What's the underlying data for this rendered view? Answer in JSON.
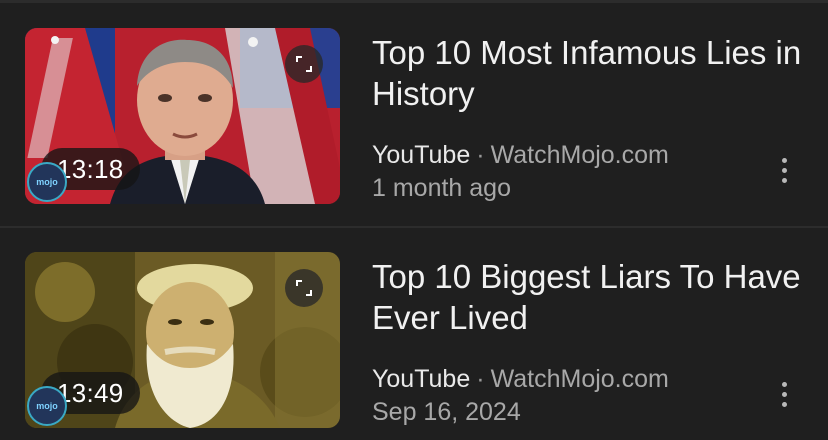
{
  "results": [
    {
      "title": "Top 10 Most Infamous Lies in History",
      "duration": "13:18",
      "source": "YouTube",
      "separator": "·",
      "channel": "WatchMojo.com",
      "date": "1 month ago",
      "icons": {
        "expand": "expand-icon",
        "more": "more-vert-icon"
      }
    },
    {
      "title": "Top 10 Biggest Liars To Have Ever Lived",
      "duration": "13:49",
      "source": "YouTube",
      "separator": "·",
      "channel": "WatchMojo.com",
      "date": "Sep 16, 2024",
      "icons": {
        "expand": "expand-icon",
        "more": "more-vert-icon"
      }
    }
  ],
  "logo_text": "mojo",
  "colors": {
    "background": "#1f1f1f",
    "title": "#f1f1f1",
    "secondary_text": "#a8a8a8"
  }
}
